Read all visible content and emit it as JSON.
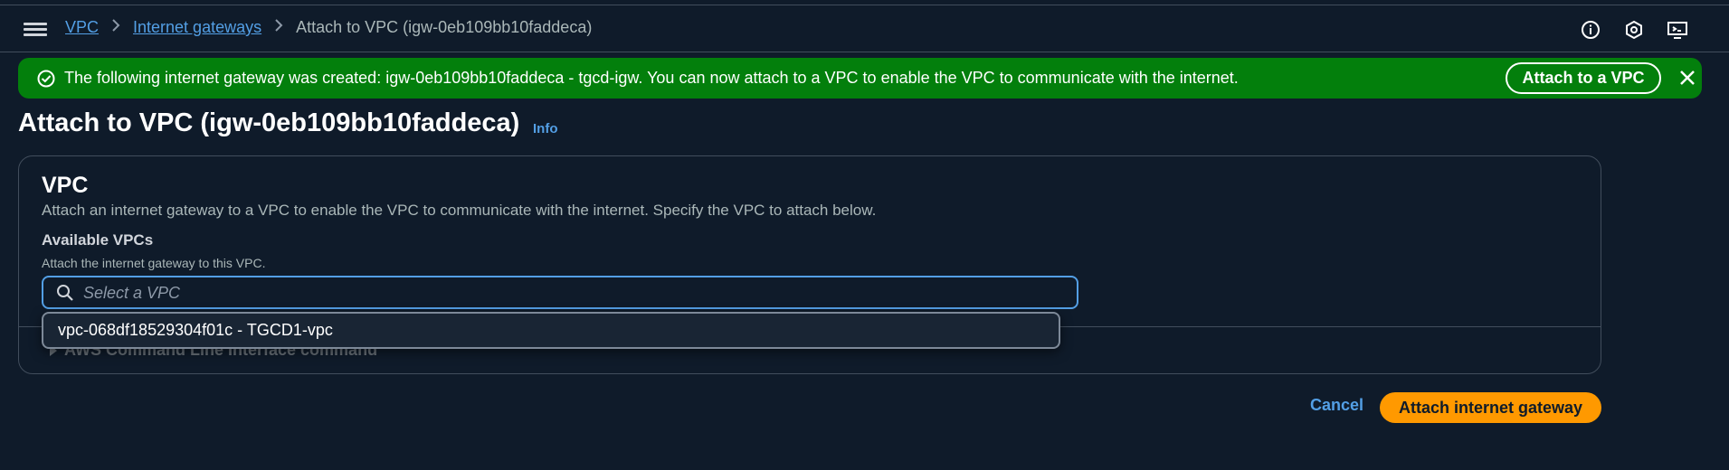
{
  "breadcrumb": {
    "items": [
      "VPC",
      "Internet gateways"
    ],
    "current": "Attach to VPC (igw-0eb109bb10faddeca)"
  },
  "header_icons": [
    "info-icon",
    "settings-hex-icon",
    "feedback-screen-icon"
  ],
  "flash": {
    "message": "The following internet gateway was created: igw-0eb109bb10faddeca - tgcd-igw. You can now attach to a VPC to enable the VPC to communicate with the internet.",
    "action_label": "Attach to a VPC",
    "color": "#037f0c"
  },
  "page": {
    "title": "Attach to VPC (igw-0eb109bb10faddeca)",
    "info_label": "Info"
  },
  "section": {
    "heading": "VPC",
    "description": "Attach an internet gateway to a VPC to enable the VPC to communicate with the internet. Specify the VPC to attach below.",
    "field_label": "Available VPCs",
    "field_description": "Attach the internet gateway to this VPC.",
    "search_placeholder": "Select a VPC",
    "expander_label": "AWS Command Line Interface command"
  },
  "dropdown": {
    "options": [
      "vpc-068df18529304f01c - TGCD1-vpc"
    ]
  },
  "footer": {
    "cancel_label": "Cancel",
    "submit_label": "Attach internet gateway"
  },
  "colors": {
    "accent": "#539fe5",
    "primary_button": "#ff9900",
    "background": "#0f1b2a"
  }
}
